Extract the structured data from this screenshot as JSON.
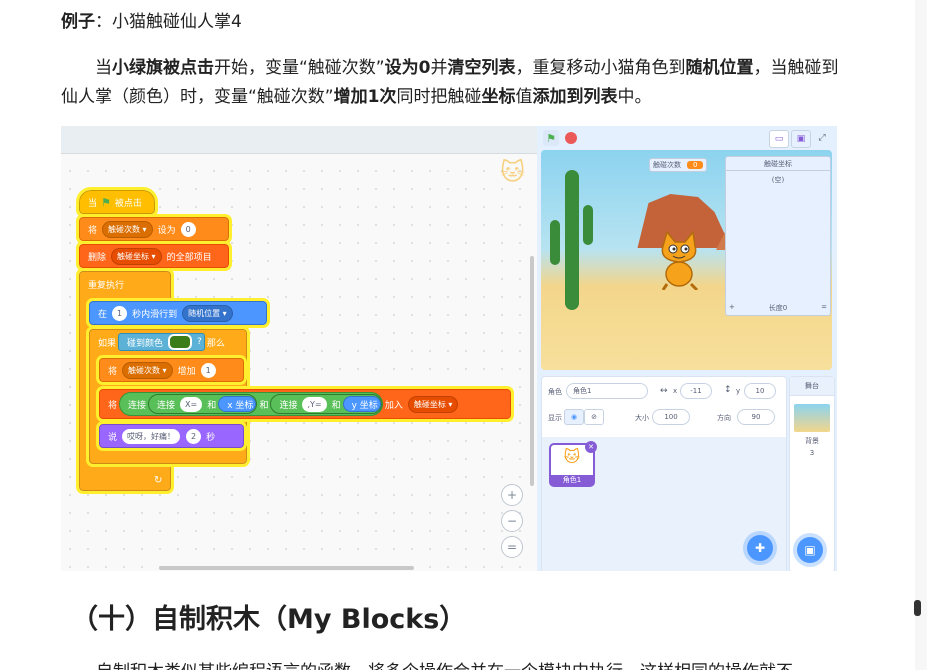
{
  "example": {
    "label": "例子",
    "sep": "：",
    "text": "小猫触碰仙人掌4"
  },
  "paragraph": {
    "s1": "当",
    "b1": "小绿旗被点击",
    "s2": "开始，变量“触碰次数”",
    "b2": "设为0",
    "s3": "并",
    "b3": "清空列表",
    "s4": "，重复移动小猫角色到",
    "b4": "随机位置",
    "s5": "，当触碰到仙人掌（颜色）时，变量“触碰次数”",
    "b5": "增加1次",
    "s6": "同时把触碰",
    "b6": "坐标",
    "s7": "值",
    "b7": "添加到列表",
    "s8": "中。"
  },
  "blocks": {
    "hat": {
      "when": "当",
      "clicked": "被点击"
    },
    "set": {
      "verb": "将",
      "var": "触碰次数",
      "to": "设为",
      "value": "0"
    },
    "delete": {
      "verb": "删除",
      "list": "触碰坐标",
      "suffix": "的全部项目"
    },
    "forever": "重复执行",
    "glide": {
      "in": "在",
      "secs": "1",
      "mid": "秒内滑行到",
      "target": "随机位置"
    },
    "if": {
      "label": "如果",
      "touch": "碰到颜色",
      "q": "?",
      "then": "那么"
    },
    "change": {
      "verb": "将",
      "var": "触碰次数",
      "by": "增加",
      "value": "1"
    },
    "add": {
      "verb": "将",
      "join": "连接",
      "xeq": "X=",
      "and": "和",
      "xpos": "x 坐标",
      "yeq": ",Y=",
      "ypos": "y 坐标",
      "into": "加入",
      "list": "触碰坐标"
    },
    "say": {
      "verb": "说",
      "msg": "哎呀，好痛！",
      "secs": "2",
      "unit": "秒"
    }
  },
  "zoom": {
    "in": "+",
    "out": "−",
    "reset": "="
  },
  "stage": {
    "var_monitor": {
      "name": "触碰次数",
      "value": "0"
    },
    "list_monitor": {
      "title": "触碰坐标",
      "empty": "(空)",
      "plus": "+",
      "length": "长度0",
      "eq": "="
    }
  },
  "sprite_info": {
    "sprite_label": "角色",
    "sprite_name": "角色1",
    "x_label": "x",
    "x": "-11",
    "y_label": "y",
    "y": "10",
    "show_label": "显示",
    "size_label": "大小",
    "size": "100",
    "dir_label": "方向",
    "dir": "90"
  },
  "sprite_tile": {
    "name": "角色1"
  },
  "stage_panel": {
    "title": "舞台",
    "backdrops_label": "背景",
    "backdrops_count": "3"
  },
  "heading": "（十）自制积木（My Blocks）",
  "tail": "自制积木类似某些编程语言的函数，将多个操作合并在一个模块中执行，这样相同的操作就不"
}
